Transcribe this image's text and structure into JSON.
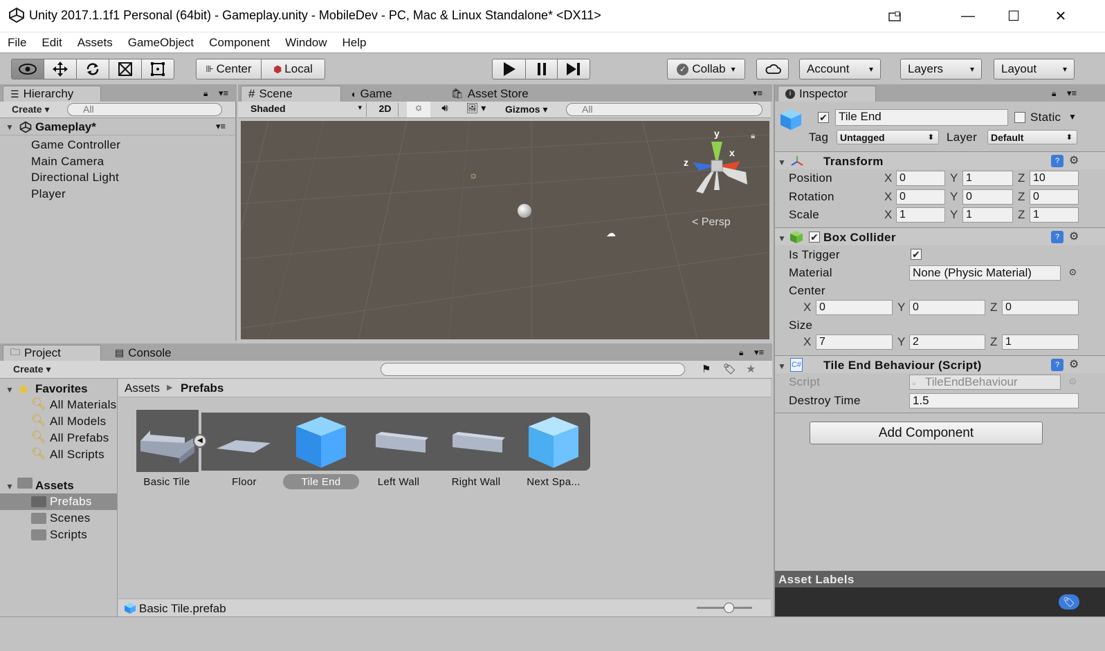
{
  "window": {
    "title": "Unity 2017.1.1f1 Personal (64bit) - Gameplay.unity - MobileDev - PC, Mac & Linux Standalone* <DX11>"
  },
  "menu": [
    "File",
    "Edit",
    "Assets",
    "GameObject",
    "Component",
    "Window",
    "Help"
  ],
  "toolbar": {
    "pivot": "Center",
    "space": "Local",
    "collab": "Collab",
    "account": "Account",
    "layers": "Layers",
    "layout": "Layout"
  },
  "hierarchy": {
    "tab": "Hierarchy",
    "create": "Create",
    "search_placeholder": "All",
    "scene": "Gameplay*",
    "items": [
      "Game Controller",
      "Main Camera",
      "Directional Light",
      "Player"
    ]
  },
  "scene": {
    "tabs": [
      "Scene",
      "Game",
      "Asset Store"
    ],
    "shading": "Shaded",
    "mode2d": "2D",
    "gizmos": "Gizmos",
    "search_placeholder": "All",
    "persp": "Persp",
    "axis_y": "y",
    "axis_x": "x",
    "axis_z": "z"
  },
  "inspector": {
    "tab": "Inspector",
    "name": "Tile End",
    "static_label": "Static",
    "tag_label": "Tag",
    "tag_value": "Untagged",
    "layer_label": "Layer",
    "layer_value": "Default",
    "transform": {
      "title": "Transform",
      "position_label": "Position",
      "rotation_label": "Rotation",
      "scale_label": "Scale",
      "position": [
        "0",
        "1",
        "10"
      ],
      "rotation": [
        "0",
        "0",
        "0"
      ],
      "scale": [
        "1",
        "1",
        "1"
      ]
    },
    "box_collider": {
      "title": "Box Collider",
      "is_trigger_label": "Is Trigger",
      "material_label": "Material",
      "material_value": "None (Physic Material)",
      "center_label": "Center",
      "center": [
        "0",
        "0",
        "0"
      ],
      "size_label": "Size",
      "size": [
        "7",
        "2",
        "1"
      ]
    },
    "script_comp": {
      "title": "Tile End Behaviour (Script)",
      "script_label": "Script",
      "script_value": "TileEndBehaviour",
      "destroy_label": "Destroy Time",
      "destroy_value": "1.5"
    },
    "add_component": "Add Component",
    "asset_labels": "Asset Labels",
    "axes": [
      "X",
      "Y",
      "Z"
    ]
  },
  "project": {
    "tabs": [
      "Project",
      "Console"
    ],
    "create": "Create",
    "favorites_label": "Favorites",
    "favorites": [
      "All Materials",
      "All Models",
      "All Prefabs",
      "All Scripts"
    ],
    "assets_label": "Assets",
    "folders": [
      "Prefabs",
      "Scenes",
      "Scripts"
    ],
    "breadcrumb_root": "Assets",
    "breadcrumb_current": "Prefabs",
    "items": [
      "Basic Tile",
      "Floor",
      "Tile End",
      "Left Wall",
      "Right Wall",
      "Next Spa..."
    ],
    "status_file": "Basic Tile.prefab"
  },
  "colors": {
    "selected_blue": "#3d7bd9",
    "scene_bg": "#5d5750",
    "panel_bg": "#c2c2c2"
  }
}
